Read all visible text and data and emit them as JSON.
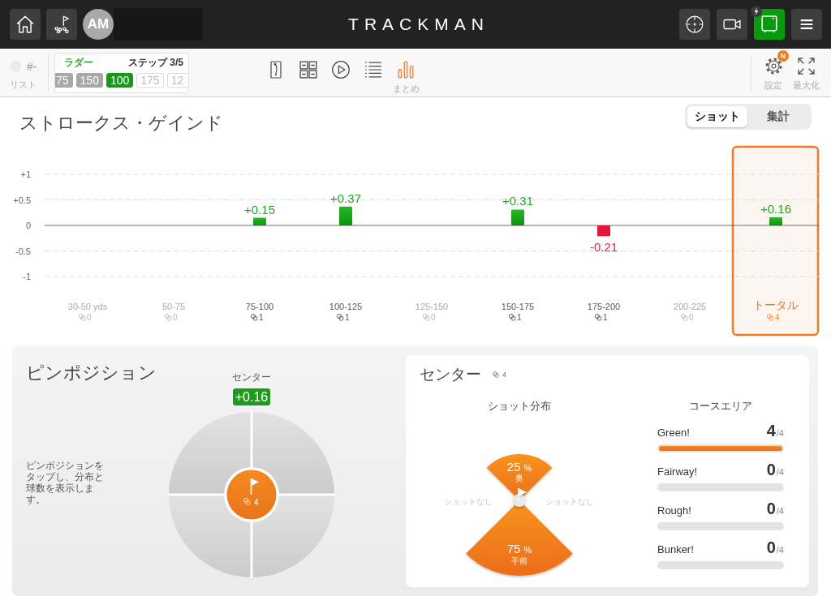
{
  "top_bar": {
    "avatar_initials": "AM",
    "logo": "TRACKMAN",
    "device_active": true
  },
  "sub_bar": {
    "list_button": {
      "number": "#-",
      "label": "リスト"
    },
    "ladder": {
      "title": "ラダー",
      "step": "ステップ 3/5",
      "targets": [
        {
          "label": "75",
          "completed": true,
          "selected": false
        },
        {
          "label": "150",
          "completed": true,
          "selected": false
        },
        {
          "label": "100",
          "completed": false,
          "selected": true
        },
        {
          "label": "175",
          "completed": false,
          "selected": false
        },
        {
          "label": "12",
          "completed": false,
          "selected": false
        }
      ]
    },
    "view_tabs": [
      {
        "selected": false
      },
      {
        "selected": false
      },
      {
        "selected": false
      },
      {
        "selected": false
      },
      {
        "selected": true,
        "label": "まとめ"
      }
    ],
    "settings": {
      "label": "設定",
      "badge": "N"
    },
    "maximize": {
      "label": "最大化"
    }
  },
  "strokes_gained": {
    "title": "ストロークス・ゲインド",
    "toggle": [
      {
        "label": "ショット",
        "selected": true
      },
      {
        "label": "集計",
        "selected": false
      }
    ],
    "chart_data": {
      "type": "bar",
      "categories": [
        "30-50 yds",
        "50-75",
        "75-100",
        "100-125",
        "125-150",
        "150-175",
        "175-200",
        "200-225",
        "トータル"
      ],
      "values": [
        null,
        null,
        0.15,
        0.37,
        null,
        0.31,
        -0.21,
        null,
        0.16
      ],
      "ylim": [
        -1,
        1
      ],
      "yticks": [
        {
          "value": 1,
          "label": "+1"
        },
        {
          "value": 0.5,
          "label": "+0.5"
        },
        0,
        -0.5,
        -1
      ],
      "value_labels": [
        null,
        null,
        "+0.15",
        "+0.37",
        null,
        "+0.31",
        "-0.21",
        null,
        "+0.16"
      ]
    },
    "columns": [
      {
        "count": "0",
        "has_shots": false,
        "selected": false
      },
      {
        "count": "0",
        "has_shots": false,
        "selected": false
      },
      {
        "count": "1",
        "has_shots": true,
        "selected": false
      },
      {
        "count": "1",
        "has_shots": true,
        "selected": false
      },
      {
        "count": "0",
        "has_shots": false,
        "selected": false
      },
      {
        "count": "1",
        "has_shots": true,
        "selected": false
      },
      {
        "count": "1",
        "has_shots": true,
        "selected": false
      },
      {
        "count": "0",
        "has_shots": false,
        "selected": false
      },
      {
        "count": "4",
        "has_shots": true,
        "selected": true
      }
    ]
  },
  "pin_position": {
    "title": "ピンポジション",
    "hint": "ピンポジションをタップし、分布と球数を表示します。",
    "selected_label": "センター",
    "score": "+0.16",
    "zones": [
      {
        "selected": false
      },
      {
        "selected": false
      },
      {
        "selected": false
      },
      {
        "selected": false
      }
    ],
    "center": {
      "selected": true,
      "count": "4"
    }
  },
  "detail": {
    "title": "センター",
    "count": "4",
    "distribution": {
      "title": "ショット分布",
      "sectors": [
        {
          "kind": "far",
          "percent": "25",
          "unit": "%",
          "label": "奥"
        },
        {
          "kind": "left",
          "empty_text": "ショットなし"
        },
        {
          "kind": "right",
          "empty_text": "ショットなし"
        },
        {
          "kind": "short",
          "percent": "75",
          "unit": "%",
          "label": "手前"
        }
      ]
    },
    "course_areas": {
      "title": "コースエリア",
      "areas": [
        {
          "name": "Green!",
          "count": "4",
          "total": "/4",
          "level": 1
        },
        {
          "name": "Fairway!",
          "count": "0",
          "total": "/4",
          "level": 0
        },
        {
          "name": "Rough!",
          "count": "0",
          "total": "/4",
          "level": 0
        },
        {
          "name": "Bunker!",
          "count": "0",
          "total": "/4",
          "level": 0
        }
      ]
    }
  }
}
